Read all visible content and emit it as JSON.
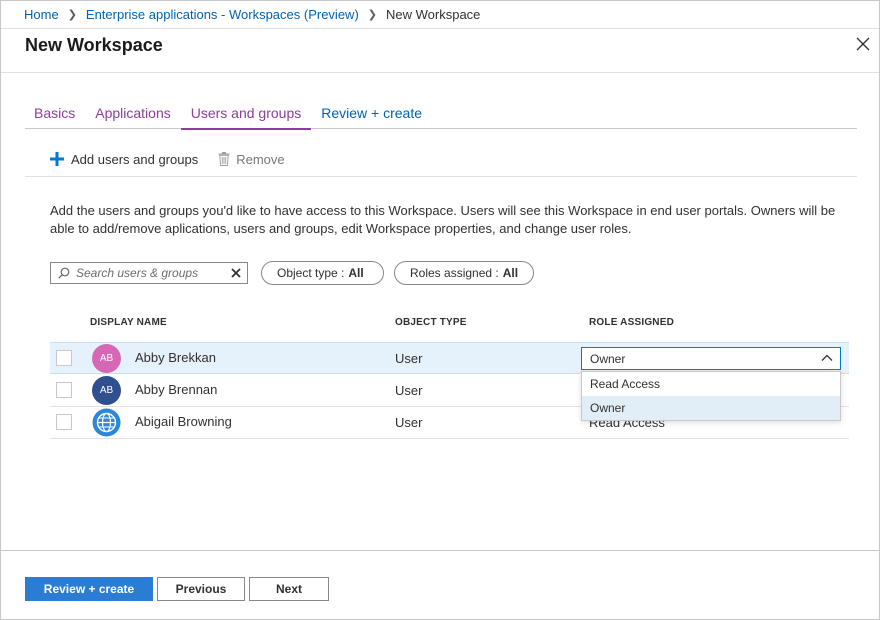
{
  "breadcrumb": {
    "items": [
      {
        "label": "Home"
      },
      {
        "label": "Enterprise applications - Workspaces (Preview)"
      }
    ],
    "current": "New Workspace"
  },
  "header": {
    "title": "New Workspace",
    "close_icon": "close-icon"
  },
  "tabs": [
    {
      "label": "Basics"
    },
    {
      "label": "Applications"
    },
    {
      "label": "Users and groups"
    },
    {
      "label": "Review + create"
    }
  ],
  "toolbar": {
    "add_label": "Add users and groups",
    "add_icon": "plus-icon",
    "remove_label": "Remove",
    "remove_icon": "trash-icon"
  },
  "description": "Add the users and groups you'd like to have access to this Workspace. Users will see this Workspace in end user portals. Owners will be able to add/remove aplications, users and groups, edit Workspace properties, and change user roles.",
  "search": {
    "placeholder": "Search users & groups",
    "value": ""
  },
  "filters": {
    "object_type": {
      "label": "Object type :",
      "value": "All"
    },
    "roles_assigned": {
      "label": "Roles assigned :",
      "value": "All"
    }
  },
  "table": {
    "columns": [
      "DISPLAY NAME",
      "OBJECT TYPE",
      "ROLE ASSIGNED"
    ],
    "rows": [
      {
        "initials": "AB",
        "name": "Abby Brekkan",
        "type": "User",
        "role": "Owner",
        "avatar_color": "#d667b5"
      },
      {
        "initials": "AB",
        "name": "Abby Brennan",
        "type": "User",
        "role": "",
        "avatar_color": "#2f4f8f"
      },
      {
        "initials": "",
        "name": "Abigail Browning",
        "type": "User",
        "role": "Read Access",
        "avatar_color": "#2b88d8"
      }
    ]
  },
  "role_dropdown": {
    "selected": "Owner",
    "options": [
      "Read Access",
      "Owner"
    ]
  },
  "footer": {
    "review_create": "Review + create",
    "previous": "Previous",
    "next": "Next"
  },
  "colors": {
    "accent": "#0078d4",
    "link": "#0063b1",
    "tab_text": "#8e3c9e",
    "primary_button": "#2b7cd3",
    "selected_row": "#e5f1fb"
  }
}
